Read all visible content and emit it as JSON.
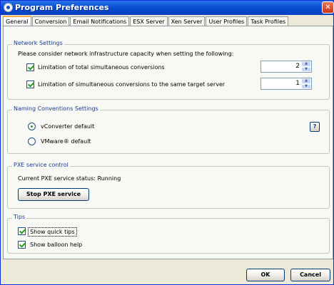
{
  "window": {
    "title": "Program Preferences",
    "close_glyph": "✕"
  },
  "tabs": [
    {
      "label": "General",
      "active": true
    },
    {
      "label": "Conversion",
      "active": false
    },
    {
      "label": "Email Notifications",
      "active": false
    },
    {
      "label": "ESX Server",
      "active": false
    },
    {
      "label": "Xen Server",
      "active": false
    },
    {
      "label": "User Profiles",
      "active": false
    },
    {
      "label": "Task Profiles",
      "active": false
    }
  ],
  "network": {
    "title": "Network Settings",
    "description": "Please consider network infrastructure capacity when setting the following:",
    "limit_total": {
      "label": "Limitation of total simultaneous conversions",
      "checked": true,
      "value": "2"
    },
    "limit_target": {
      "label": "Limitation of simultaneous conversions to the same target server",
      "checked": true,
      "value": "1"
    },
    "spin_up": "▲",
    "spin_down": "▼"
  },
  "naming": {
    "title": "Naming Conventions Settings",
    "options": [
      {
        "label": "vConverter default",
        "selected": true
      },
      {
        "label": "VMware® default",
        "selected": false
      }
    ],
    "help_label": "?"
  },
  "pxe": {
    "title": "PXE service control",
    "status_text": "Current PXE service status: Running",
    "stop_button": "Stop PXE service"
  },
  "tips": {
    "title": "Tips",
    "show_quick_tips": {
      "label": "Show quick tips",
      "checked": true
    },
    "show_balloon_help": {
      "label": "Show balloon help",
      "checked": true
    }
  },
  "footer": {
    "ok": "OK",
    "cancel": "Cancel"
  },
  "colors": {
    "titlebar": "#0a4fd2",
    "group_title": "#1e3c8c",
    "check": "#21a121"
  }
}
